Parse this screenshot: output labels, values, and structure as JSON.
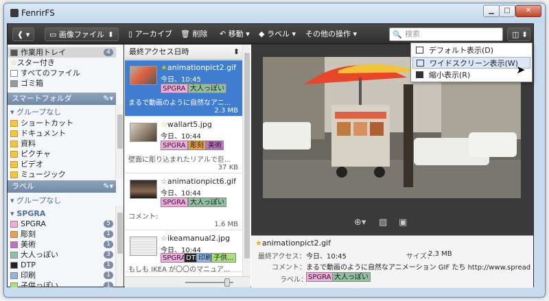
{
  "window": {
    "title": "FenrirFS",
    "min": "▁",
    "max": "□",
    "close": "✕"
  },
  "toolbar": {
    "profile_caret": "▾",
    "filter": "画像ファイル",
    "filter_arrows": "⬍",
    "archive": "アーカイブ",
    "delete": "削除",
    "move": "移動",
    "label": "ラベル",
    "other": "その他の操作",
    "search_placeholder": "検索",
    "view_caret": "⬍"
  },
  "sidebar": {
    "top_items": [
      {
        "label": "作業用トレイ",
        "count": "4"
      },
      {
        "label": "スター付き"
      },
      {
        "label": "すべてのファイル"
      },
      {
        "label": "ゴミ箱"
      }
    ],
    "smart_header": "スマートフォルダ",
    "smart_group": "グループなし",
    "smart_items": [
      "ショートカット",
      "ドキュメント",
      "資料",
      "ピクチャ",
      "ビデオ",
      "ミュージック"
    ],
    "label_header": "ラベル",
    "label_group": "グループなし",
    "label_group2": "SPGRA",
    "labels": [
      {
        "label": "SPGRA",
        "count": "5"
      },
      {
        "label": "彫刻",
        "count": "1"
      },
      {
        "label": "美術",
        "count": "1"
      },
      {
        "label": "大人っぽい",
        "count": "3"
      },
      {
        "label": "DTP",
        "count": "1"
      },
      {
        "label": "印刷",
        "count": "1"
      },
      {
        "label": "子供っぽい",
        "count": "1"
      }
    ]
  },
  "list": {
    "sort_label": "最終アクセス日時",
    "items": [
      {
        "name": "animationpict2.gif",
        "date": "今日、10:45",
        "tags": [
          "SPGRA",
          "大人っぽい"
        ],
        "desc": "まるで動画のように自然なアニ...",
        "size": "2.3 MB"
      },
      {
        "name": "wallart5.jpg",
        "date": "今日、10:44",
        "tags": [
          "SPGRA",
          "彫刻",
          "美術"
        ],
        "desc": "壁面に彫り込まれたリアルで巨...",
        "size": "37 KB"
      },
      {
        "name": "animationpict6.gif",
        "date": "今日、10:44",
        "tags": [
          "SPGRA",
          "大人っぽい"
        ],
        "desc": "コメント:",
        "size": "1.6 MB"
      },
      {
        "name": "ikeamanual2.jpg",
        "date": "今日、10:44",
        "tags": [
          "SPGRA",
          "DTP",
          "印刷",
          "子供..."
        ],
        "desc": "もしも IKEA が〇〇のマニュア...",
        "size": ""
      }
    ]
  },
  "preview": {
    "filename": "animationpict2.gif",
    "access_label": "最終アクセス：",
    "access_value": "今日、10:45",
    "size_label": "サイズ：",
    "size_value": "2.3 MB",
    "comment_label": "コメント：",
    "comment_value": "まるで動画のように自然なアニメーション GIF たち  http://www.spread",
    "label_label": "ラベル：",
    "labels": [
      "SPGRA",
      "大人っぽい"
    ]
  },
  "view_menu": {
    "items": [
      "デフォルト表示(D)",
      "ワイドスクリーン表示(W)",
      "縮小表示(R)"
    ]
  },
  "colors": {
    "accent": "#3f7dd0",
    "toolbar": "#3a3a3a",
    "tag_pink": "#f6a8e0",
    "tag_green": "#8fbf9f",
    "tag_blue": "#8fb4e8",
    "tag_orange": "#f0a040"
  }
}
